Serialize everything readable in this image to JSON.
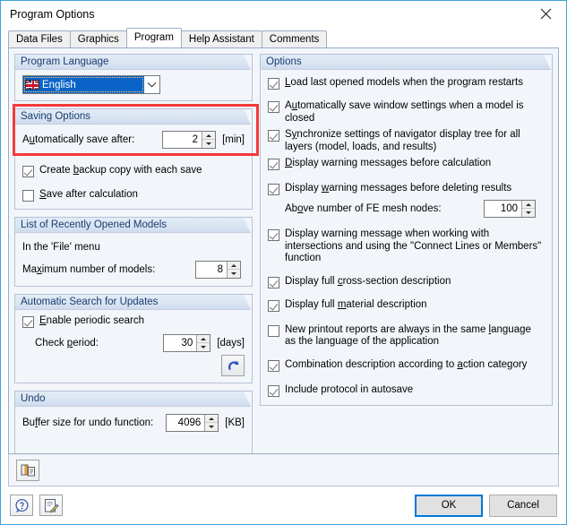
{
  "window": {
    "title": "Program Options",
    "close_icon": "close-icon"
  },
  "tabs": [
    {
      "label": "Data Files",
      "active": false
    },
    {
      "label": "Graphics",
      "active": false
    },
    {
      "label": "Program",
      "active": true
    },
    {
      "label": "Help Assistant",
      "active": false
    },
    {
      "label": "Comments",
      "active": false
    }
  ],
  "left": {
    "program_language": {
      "header": "Program Language",
      "selected": "English",
      "flag_icon": "uk-flag-icon",
      "dropdown_icon": "chevron-down-icon"
    },
    "saving_options": {
      "header": "Saving Options",
      "autosave_label_pre": "A",
      "autosave_label_key": "u",
      "autosave_label_post": "tomatically save after:",
      "autosave_value": "2",
      "autosave_unit": "[min]",
      "backup_label_pre": "Create ",
      "backup_label_key": "b",
      "backup_label_post": "ackup copy with each save",
      "backup_checked": true,
      "save_after_calc_pre": "",
      "save_after_calc_key": "S",
      "save_after_calc_post": "ave after calculation",
      "save_after_calc_checked": false
    },
    "recent_models": {
      "header": "List of Recently Opened Models",
      "menu_note": "In the 'File' menu",
      "max_label_pre": "Ma",
      "max_label_key": "x",
      "max_label_post": "imum number of models:",
      "max_value": "8"
    },
    "updates": {
      "header": "Automatic Search for Updates",
      "enable_pre": "",
      "enable_key": "E",
      "enable_post": "nable periodic search",
      "enable_checked": true,
      "period_pre": "Check ",
      "period_key": "p",
      "period_post": "eriod:",
      "period_value": "30",
      "period_unit": "[days]",
      "refresh_icon": "refresh-arrow-icon"
    },
    "undo": {
      "header": "Undo",
      "buffer_pre": "Bu",
      "buffer_key": "f",
      "buffer_post": "fer size for undo function:",
      "buffer_value": "4096",
      "buffer_unit": "[KB]"
    }
  },
  "right": {
    "header": "Options",
    "items": [
      {
        "pre": "",
        "key": "L",
        "post": "oad last opened models when the program restarts",
        "checked": true,
        "gap": 12
      },
      {
        "pre": "A",
        "key": "u",
        "post": "tomatically save window settings when a model is closed",
        "checked": true,
        "gap": 4
      },
      {
        "pre": "S",
        "key": "y",
        "post": "nchronize settings of navigator display tree for all layers (model, loads, and results)",
        "checked": true,
        "gap": 4
      },
      {
        "pre": "",
        "key": "D",
        "post": "isplay warning messages before calculation",
        "checked": true,
        "gap": 12
      },
      {
        "pre": "Display ",
        "key": "w",
        "post": "arning messages before deleting results",
        "checked": true,
        "gap": 4
      },
      {
        "pre": "Display warning messa",
        "key": "g",
        "post": "e when working with intersections and using the \"Connect Lines or Members\" function",
        "checked": true,
        "gap": 12
      },
      {
        "pre": "Display full ",
        "key": "c",
        "post": "ross-section description",
        "checked": true,
        "gap": 4
      },
      {
        "pre": "Display full ",
        "key": "m",
        "post": "aterial description",
        "checked": true,
        "gap": 10
      },
      {
        "pre": "New printout reports are always in the same ",
        "key": "l",
        "post": "anguage as the language of the application",
        "checked": false,
        "gap": 10
      },
      {
        "pre": "Combination description according to ",
        "key": "a",
        "post": "ction category",
        "checked": true,
        "gap": 4
      },
      {
        "pre": "Include protocol in autosave",
        "key": "",
        "post": "",
        "checked": true,
        "gap": 4
      }
    ],
    "fe_nodes": {
      "label_pre": "Ab",
      "label_key": "o",
      "label_post": "ve number of FE mesh nodes:",
      "value": "100"
    }
  },
  "bottombar": {
    "settings_icon": "display-properties-icon"
  },
  "footer": {
    "help_icon": "help-question-icon",
    "notes_icon": "edit-notes-icon",
    "ok_label": "OK",
    "cancel_label": "Cancel"
  },
  "colors": {
    "accent": "#0078d7",
    "highlight": "#f43a3a",
    "group_header_text": "#1a3c6e",
    "selection": "#0a64c8",
    "panel_bg": "#f2f5fa"
  }
}
